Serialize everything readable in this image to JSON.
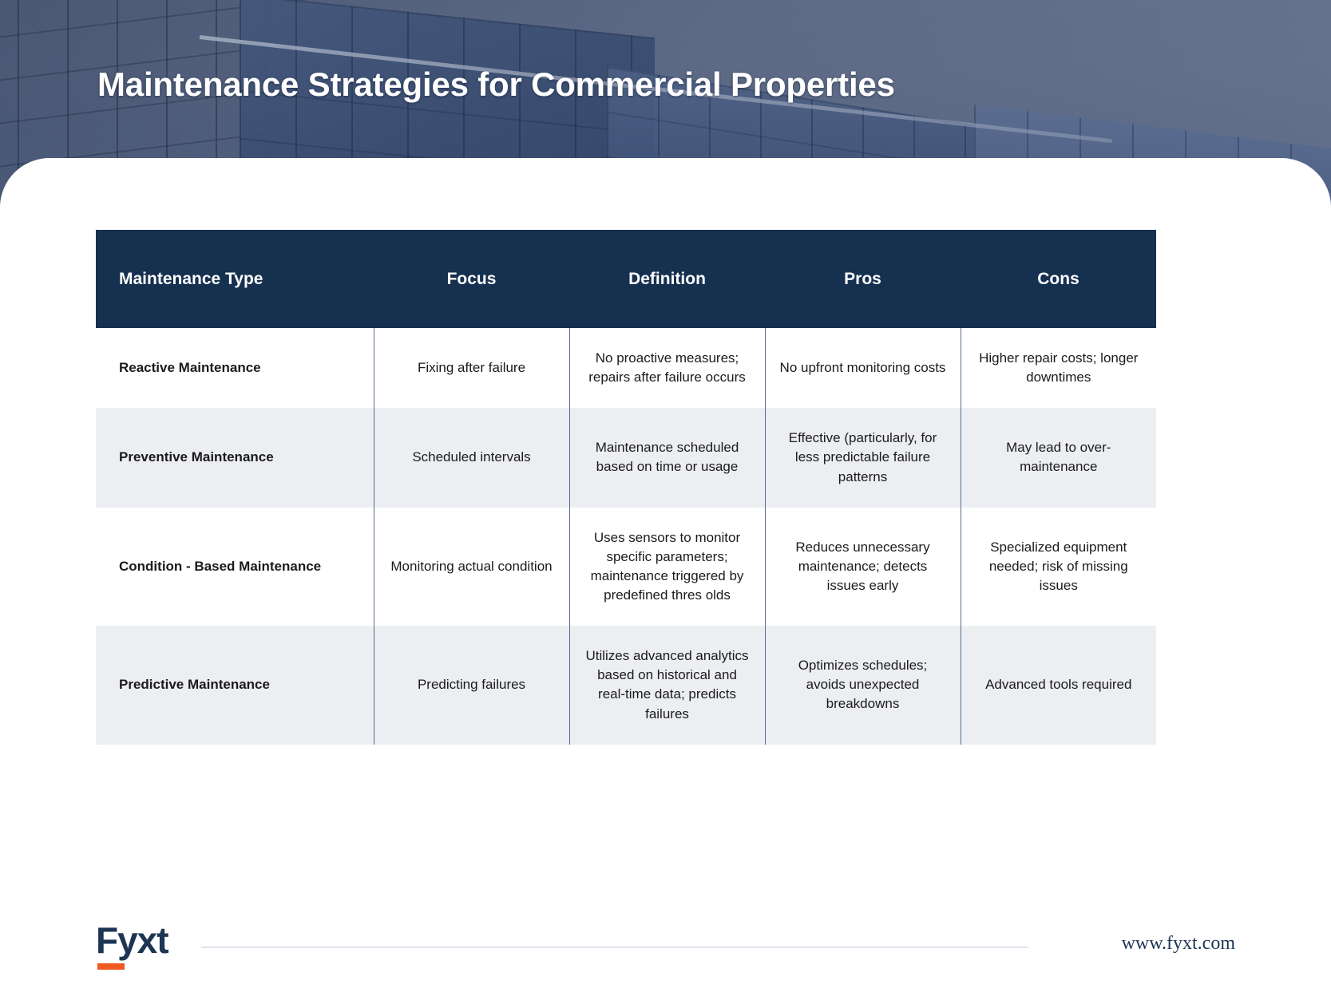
{
  "hero": {
    "title": "Maintenance Strategies for Commercial Properties",
    "background_image": "commercial-building-glass-facade",
    "overlay_color": "#2d3c5c"
  },
  "table": {
    "header_bg": "#16304f",
    "header_text_color": "#ffffff",
    "stripe_color": "#eceef2",
    "divider_color": "#5a6b8c",
    "columns": [
      "Maintenance Type",
      "Focus",
      "Definition",
      "Pros",
      "Cons"
    ],
    "rows": [
      {
        "type": "Reactive Maintenance",
        "focus": "Fixing after failure",
        "definition": "No proactive measures; repairs after failure occurs",
        "pros": "No upfront monitoring costs",
        "cons": "Higher repair costs; longer downtimes"
      },
      {
        "type": "Preventive Maintenance",
        "focus": "Scheduled intervals",
        "definition": "Maintenance scheduled based on time or usage",
        "pros": "Effective (particularly, for less predictable failure patterns",
        "cons": "May lead to over-maintenance"
      },
      {
        "type": "Condition - Based Maintenance",
        "focus": "Monitoring actual condition",
        "definition": "Uses sensors to monitor specific parameters; maintenance triggered by predefined thres olds",
        "pros": "Reduces unnecessary maintenance; detects issues early",
        "cons": "Specialized equipment needed; risk of missing issues"
      },
      {
        "type": "Predictive Maintenance",
        "focus": "Predicting failures",
        "definition": "Utilizes advanced analytics based on historical and real-time data; predicts failures",
        "pros": "Optimizes schedules; avoids unexpected breakdowns",
        "cons": "Advanced tools required"
      }
    ]
  },
  "footer": {
    "logo_text": "Fyxt",
    "logo_accent_color": "#f05a22",
    "logo_color": "#1d3453",
    "url": "www.fyxt.com"
  }
}
